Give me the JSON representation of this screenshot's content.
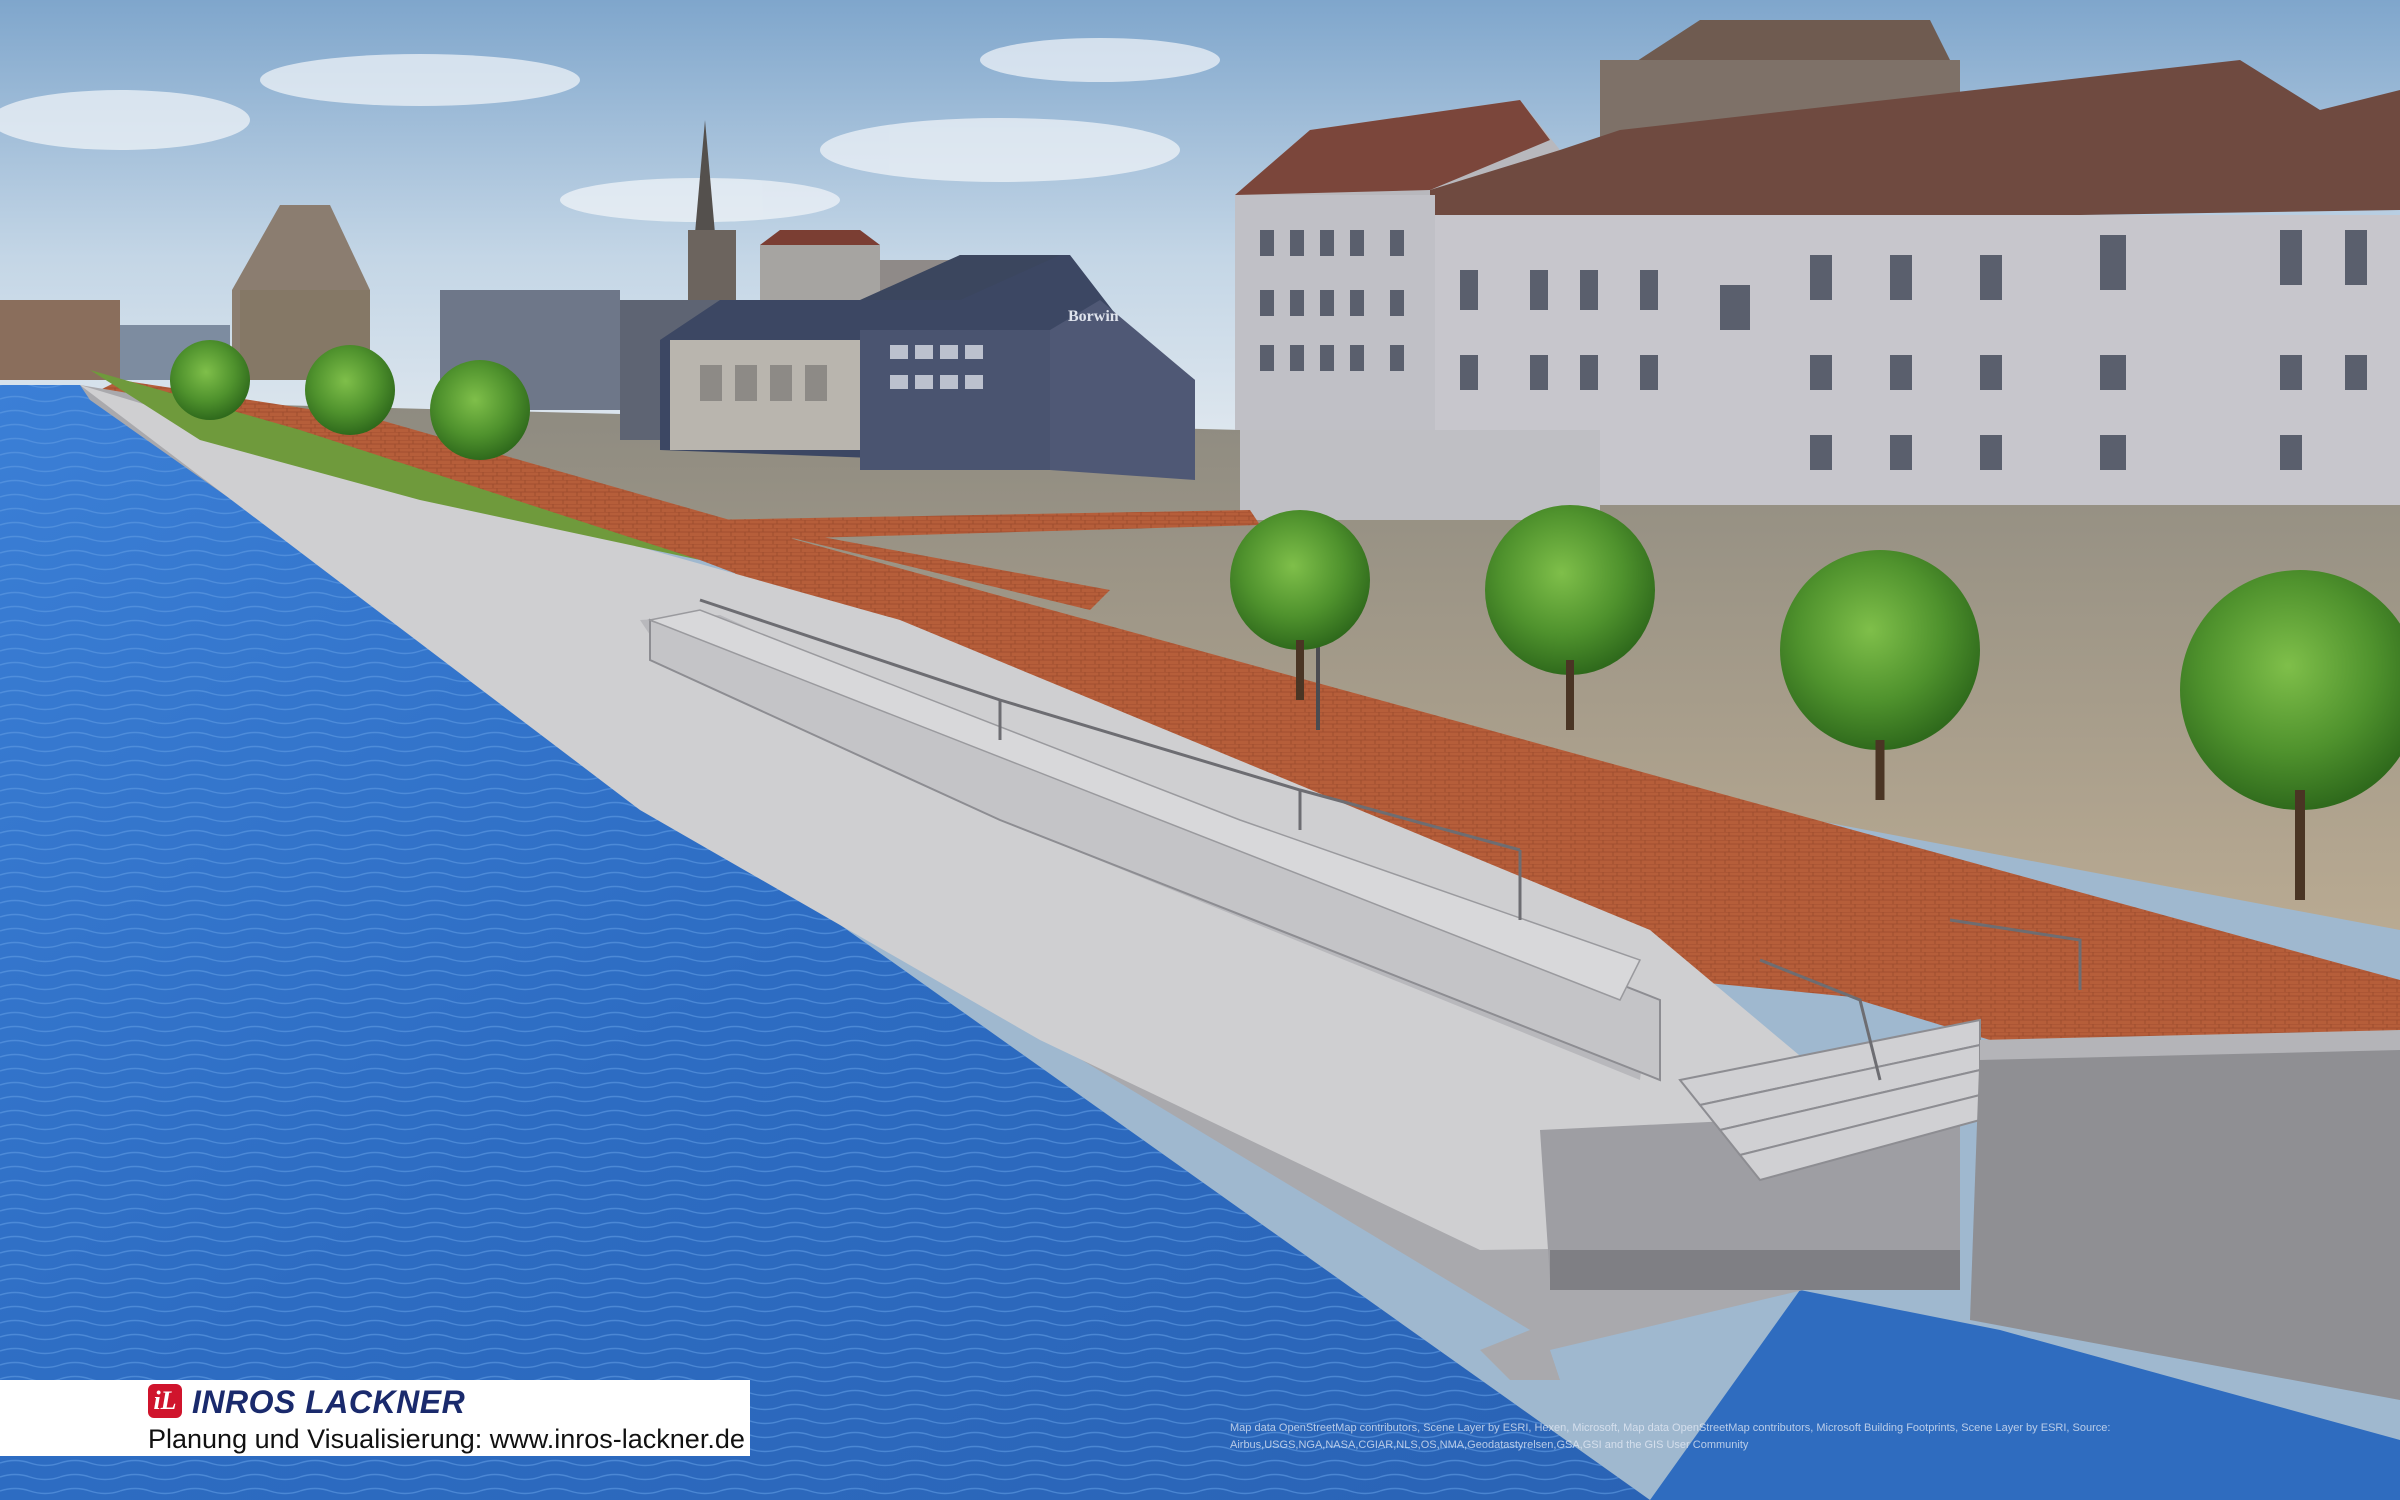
{
  "image": {
    "description_tags": [
      "waterfront-rendering",
      "quay-promenade",
      "river",
      "city-buildings"
    ]
  },
  "logo": {
    "mark": "iL",
    "brand": "INROS LACKNER",
    "tagline": "Planung und Visualisierung: www.inros-lackner.de",
    "brand_color": "#1a2a6c",
    "mark_color": "#d0142c"
  },
  "signs": {
    "building_sign": "Borwin"
  },
  "attribution": "Map data OpenStreetMap contributors, Scene Layer by ESRI, Hexen, Microsoft, Map data OpenStreetMap contributors, Microsoft Building Footprints, Scene Layer by ESRI, Source: Airbus,USGS,NGA,NASA,CGIAR,NLS,OS,NMA,Geodatastyrelsen,GSA,GSI and the GIS User Community",
  "colors": {
    "water": "#2f6fc4",
    "brick_paving": "#b8603d",
    "concrete": "#c9c9c9",
    "grass": "#6f9a3c",
    "sky": "#a9c4dc"
  }
}
